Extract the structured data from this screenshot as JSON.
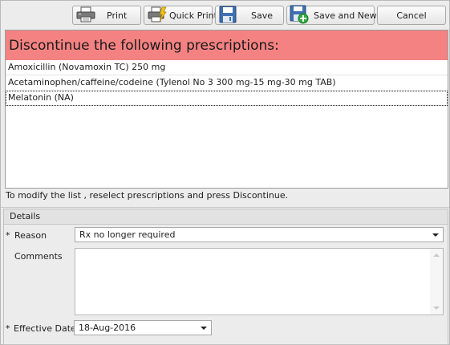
{
  "toolbar": {
    "print": "Print",
    "quick_print": "Quick Print",
    "save": "Save",
    "save_and_new": "Save and New",
    "cancel": "Cancel"
  },
  "panel": {
    "header": "Discontinue the following prescriptions:",
    "items": [
      "Amoxicillin (Novamoxin TC) 250 mg",
      "Acetaminophen/caffeine/codeine (Tylenol No 3 300 mg-15 mg-30 mg TAB)",
      "Melatonin (NA)"
    ],
    "hint": "To modify the list , reselect prescriptions and press Discontinue."
  },
  "details": {
    "title": "Details",
    "required_marker": "*",
    "reason_label": "Reason",
    "reason_value": "Rx no longer required",
    "comments_label": "Comments",
    "comments_value": "",
    "effective_date_label": "Effective Date",
    "effective_date_value": "18-Aug-2016"
  },
  "colors": {
    "header_bg": "#f48282",
    "window_bg": "#ececec"
  }
}
